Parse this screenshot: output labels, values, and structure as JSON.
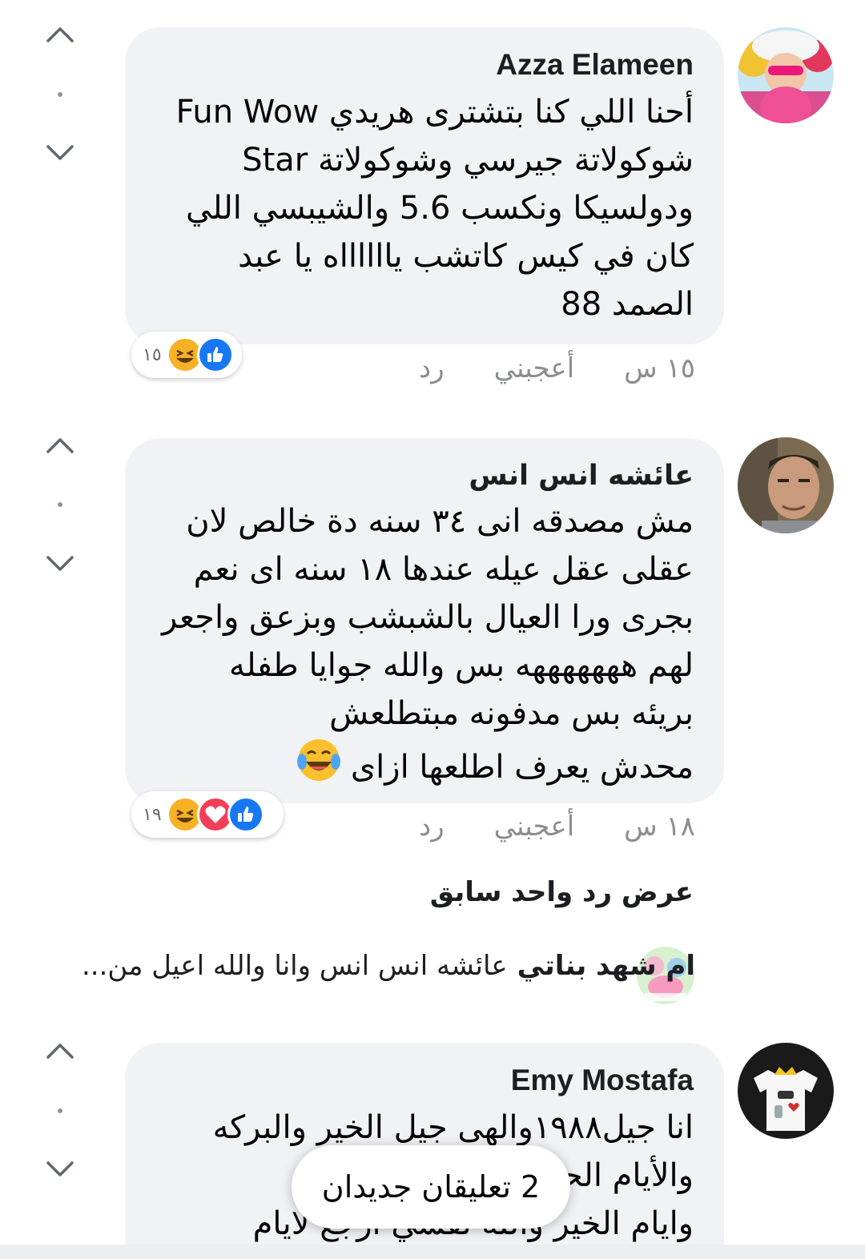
{
  "comments": [
    {
      "author": "Azza Elameen",
      "lines": [
        "أحنا اللي كنا بتشترى هريدي Fun Wow",
        "شوكولاتة جيرسي وشوكولاتة Star",
        "ودولسيكا ونكسب 5.6 والشيبسي اللي",
        "كان في كيس كاتشب يااااااه يا عبد",
        "الصمد 88"
      ],
      "reaction_count": "١٥",
      "reactions": [
        "like-icon",
        "haha-icon"
      ],
      "time": "١٥ س",
      "like_label": "أعجبني",
      "reply_label": "رد"
    },
    {
      "author": "عائشه انس انس",
      "lines": [
        "مش مصدقه انى ٣٤ سنه دة خالص لان",
        "عقلى عقل عيله عندها ١٨ سنه اى نعم",
        "بجرى ورا العيال بالشبشب وبزعق واجعر",
        "لهم  هههههههه بس والله جوايا طفله",
        "بريئه بس مدفونه مبتطلعش",
        "محدش يعرف اطلعها ازاى"
      ],
      "trailing_emoji": "laughing-tears-emoji",
      "reaction_count": "١٩",
      "reactions": [
        "like-icon",
        "love-icon",
        "haha-icon"
      ],
      "time": "١٨ س",
      "like_label": "أعجبني",
      "reply_label": "رد"
    },
    {
      "author": "Emy Mostafa",
      "lines": [
        "انا جيل١٩٨٨والهى جيل الخير والبركه",
        "والأيام الحلوه والناس الحلوه",
        "وايام الخير والله نفسي ارجع لايام"
      ]
    }
  ],
  "previous_replies_label": "عرض رد واحد سابق",
  "reply_preview": {
    "author": "ام شهد بناتي",
    "text": "عائشه انس انس وانا والله اعيل من..."
  },
  "new_comments_toast": "2 تعليقان جديدان",
  "colors": {
    "bubble": "#f0f2f5",
    "like": "#1877f2",
    "love": "#f33e58",
    "haha": "#f7b125",
    "meta": "#8a8d91"
  }
}
